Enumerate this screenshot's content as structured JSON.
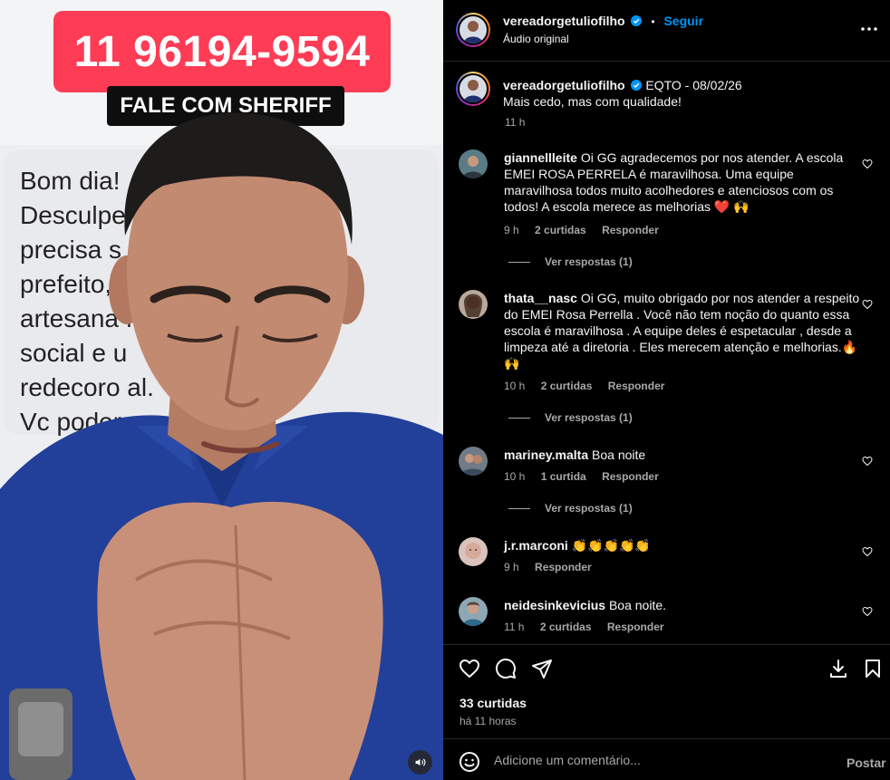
{
  "media": {
    "phone_text": "11 96194-9594",
    "caption_text": "FALE COM SHERIFF",
    "message_lines": [
      "Bom dia!",
      "Desculpe                        mas vc",
      "precisa s                        do",
      "prefeito,                        de",
      "artesana                      fundo",
      "social e u",
      "redecoro                     al.",
      "Vc poder"
    ],
    "sound_icon": "speaker-icon"
  },
  "header": {
    "username": "vereadorgetuliofilho",
    "follow_label": "Seguir",
    "audio_label": "Áudio original",
    "bullet": "•"
  },
  "caption": {
    "username": "vereadorgetuliofilho",
    "text": "EQTO - 08/02/26",
    "line2": "Mais cedo, mas com qualidade!",
    "time": "11 h"
  },
  "comments": [
    {
      "username": "giannellleite",
      "text": "Oi GG agradecemos por nos atender. A escola EMEI ROSA PERRELA é maravilhosa. Uma equipe maravilhosa todos muito acolhedores e atenciosos com os todos! A escola merece as melhorias ❤️ 🙌",
      "time": "9 h",
      "likes": "2 curtidas",
      "reply": "Responder",
      "view_replies": "Ver respostas (1)"
    },
    {
      "username": "thata__nasc",
      "text": "Oi GG, muito obrigado por nos atender a respeito do EMEI Rosa Perrella . Você não tem noção do quanto essa escola é maravilhosa . A equipe deles é espetacular , desde a limpeza até a diretoria . Eles merecem atenção e melhorias.🔥 🙌",
      "time": "10 h",
      "likes": "2 curtidas",
      "reply": "Responder",
      "view_replies": "Ver respostas (1)"
    },
    {
      "username": "mariney.malta",
      "text": "Boa noite",
      "time": "10 h",
      "likes": "1 curtida",
      "reply": "Responder",
      "view_replies": "Ver respostas (1)"
    },
    {
      "username": "j.r.marconi",
      "text": "👏👏👏👏👏",
      "time": "9 h",
      "reply": "Responder"
    },
    {
      "username": "neidesinkevicius",
      "text": "Boa noite.",
      "time": "11 h",
      "likes": "2 curtidas",
      "reply": "Responder"
    }
  ],
  "footer": {
    "likes": "33 curtidas",
    "date": "há 11 horas",
    "input_placeholder": "Adicione um comentário...",
    "post_label": "Postar"
  },
  "colors": {
    "accent": "#0095f6",
    "phone_badge": "#fe3c55",
    "heart_red": "#ff3040"
  }
}
